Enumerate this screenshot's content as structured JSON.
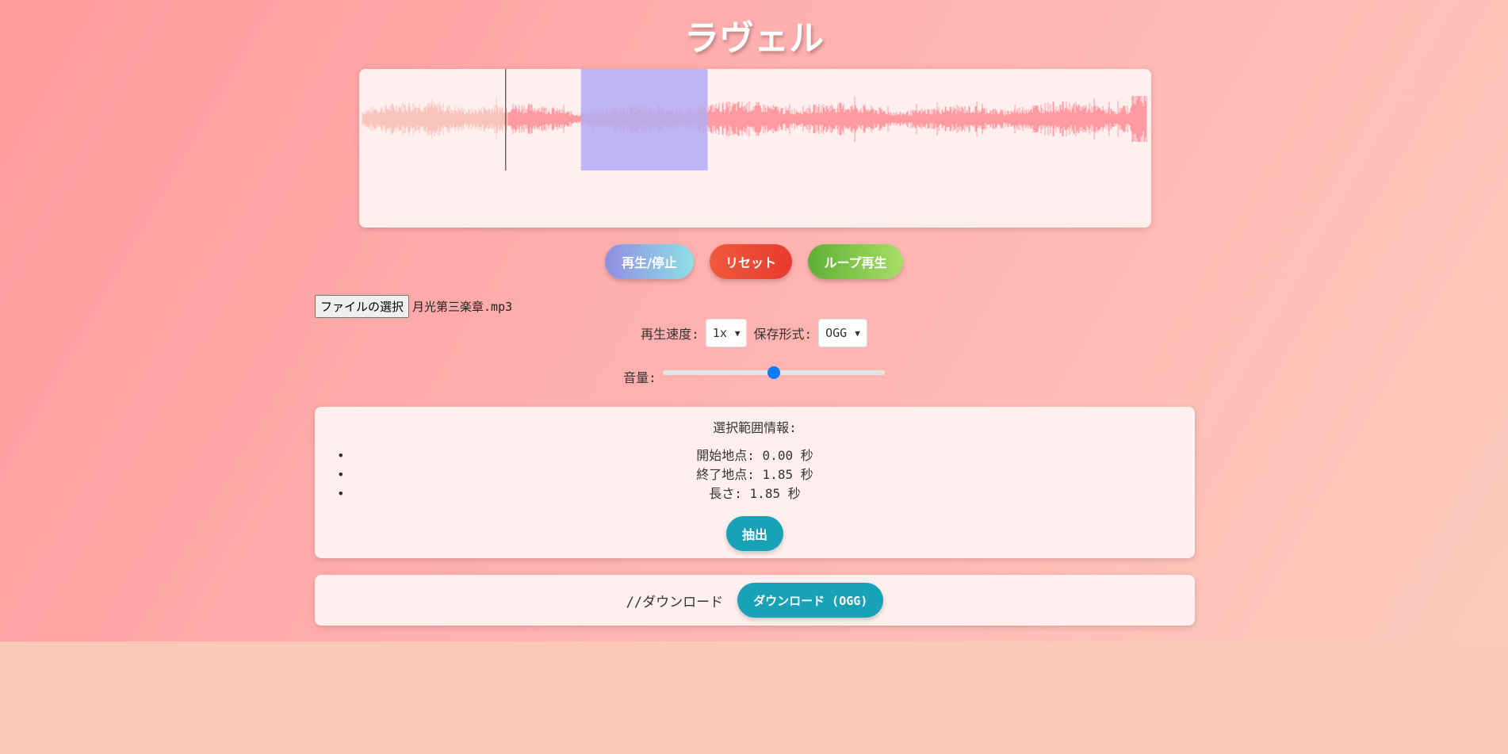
{
  "app": {
    "title": "ラヴェル"
  },
  "waveform": {
    "selection": {
      "start_fraction": 0.28,
      "end_fraction": 0.44
    },
    "cursor_fraction": 0.185,
    "played_fraction": 0.185,
    "colors": {
      "played": "#f8c4bc",
      "unplayed": "#ff9aa0",
      "selection": "#b3aaf2",
      "cursor": "#222222"
    }
  },
  "controls": {
    "play_pause_label": "再生/停止",
    "reset_label": "リセット",
    "loop_label": "ループ再生"
  },
  "file": {
    "choose_label": "ファイルの選択",
    "file_name": "月光第三楽章.mp3"
  },
  "settings": {
    "speed_label": "再生速度:",
    "speed_value": "1x",
    "format_label": "保存形式:",
    "format_value": "OGG",
    "volume_label": "音量:",
    "volume_fraction": 0.5
  },
  "selection_info": {
    "heading": "選択範囲情報:",
    "items": [
      {
        "text": "開始地点: 0.00 秒"
      },
      {
        "text": "終了地点: 1.85 秒"
      },
      {
        "text": "長さ: 1.85 秒"
      }
    ],
    "extract_label": "抽出"
  },
  "download": {
    "comment": "//ダウンロード",
    "button_label": "ダウンロード (OGG)"
  }
}
